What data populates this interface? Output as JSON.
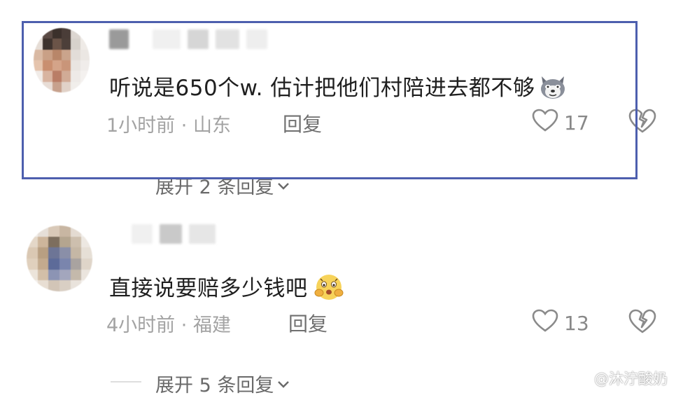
{
  "comments": [
    {
      "text": "听说是650个w. 估计把他们村陪进去都不够",
      "emoji": "husky-dog-face-emoji",
      "time": "1小时前",
      "separator": "·",
      "location": "山东",
      "reply_label": "回复",
      "likes": "17",
      "expand_label": "展开 2 条回复",
      "highlighted": true
    },
    {
      "text": "直接说要赔多少钱吧",
      "emoji": "scared-crying-face-emoji",
      "time": "4小时前",
      "separator": "·",
      "location": "福建",
      "reply_label": "回复",
      "likes": "13",
      "expand_label": "展开 5 条回复",
      "highlighted": false
    }
  ],
  "watermark": {
    "text": "@沐泞酸奶"
  },
  "colors": {
    "highlight_border": "#4d5fae",
    "meta_gray": "#a3a3a3",
    "text_dark": "#1f1f1f"
  }
}
